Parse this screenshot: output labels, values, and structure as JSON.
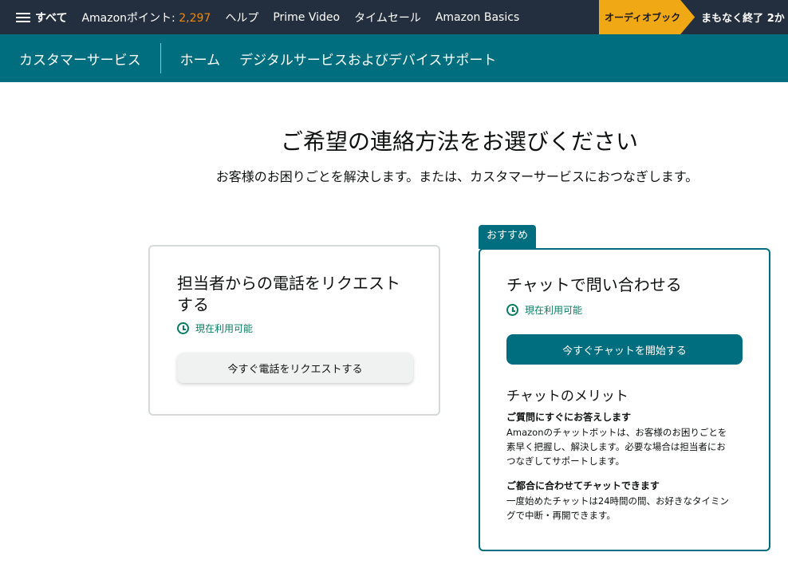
{
  "topnav": {
    "all_label": "すべて",
    "points_label": "Amazonポイント:",
    "points_value": "2,297",
    "links": [
      "ヘルプ",
      "Prime Video",
      "タイムセール",
      "Amazon Basics"
    ],
    "promo_badge": "オーディオブック",
    "promo_text": "まもなく終了 2か"
  },
  "subnav": {
    "section": "カスタマーサービス",
    "items": [
      "ホーム",
      "デジタルサービスおよびデバイスサポート"
    ]
  },
  "main": {
    "heading": "ご希望の連絡方法をお選びください",
    "subheading": "お客様のお困りごとを解決します。または、カスタマーサービスにおつなぎします。"
  },
  "phone_card": {
    "title_line1": "担当者からの電話をリクエスト",
    "title_line2": "する",
    "status": "現在利用可能",
    "button": "今すぐ電話をリクエストする"
  },
  "chat_card": {
    "recommended_tag": "おすすめ",
    "title": "チャットで問い合わせる",
    "status": "現在利用可能",
    "button": "今すぐチャットを開始する",
    "benefits_title": "チャットのメリット",
    "benefits": [
      {
        "heading": "ご質問にすぐにお答えします",
        "lines": [
          "Amazonのチャットボットは、お客様のお困りごとを",
          "素早く把握し、解決します。必要な場合は担当者にお",
          "つなぎしてサポートします。"
        ]
      },
      {
        "heading": "ご都合に合わせてチャットできます",
        "lines": [
          "一度始めたチャットは24時間の間、お好きなタイミン",
          "グで中断・再開できます。"
        ]
      }
    ]
  },
  "colors": {
    "nav_bg": "#232f3e",
    "teal": "#006e7e",
    "points": "#f08804",
    "promo": "#f0a814",
    "available_green": "#067d62"
  }
}
